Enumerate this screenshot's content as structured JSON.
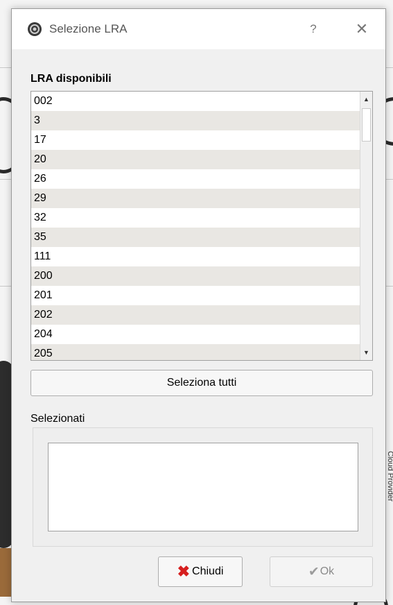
{
  "window": {
    "title": "Selezione LRA",
    "help": "?",
    "close": "✕"
  },
  "available": {
    "label": "LRA disponibili",
    "items": [
      "002",
      "3",
      "17",
      "20",
      "26",
      "29",
      "32",
      "35",
      "111",
      "200",
      "201",
      "202",
      "204",
      "205"
    ]
  },
  "select_all_label": "Seleziona tutti",
  "selected": {
    "label": "Selezionati",
    "items": []
  },
  "buttons": {
    "close_label": "Chiudi",
    "ok_label": "Ok"
  },
  "background": {
    "side_text": "Cloud Provider"
  },
  "icons": {
    "app": "lra-target-icon",
    "close": "x-icon",
    "ok": "check-icon",
    "scroll_up": "arrow-up-icon",
    "scroll_down": "arrow-down-icon"
  }
}
